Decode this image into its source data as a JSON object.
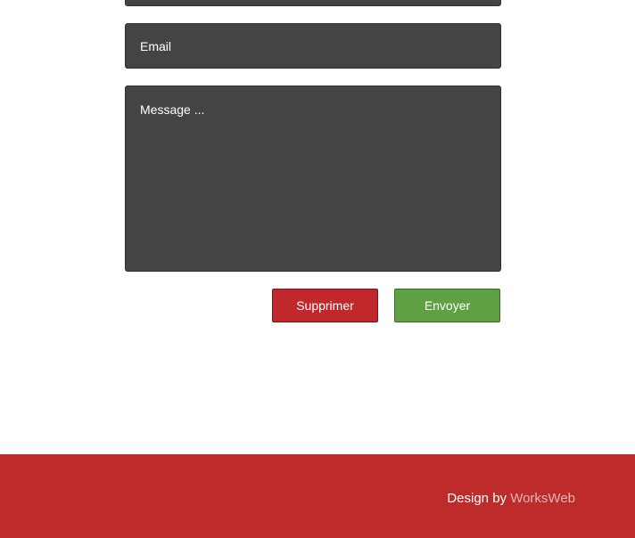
{
  "form": {
    "email_placeholder": "Email",
    "message_placeholder": "Message ...",
    "delete_label": "Supprimer",
    "send_label": "Envoyer"
  },
  "footer": {
    "credit_prefix": "Design by",
    "credit_link": "WorksWeb"
  },
  "colors": {
    "field_background": "#444444",
    "delete_button": "#c0282b",
    "send_button": "#5ea043",
    "footer_background": "#bd2b2b",
    "link_color": "#e0b8b8"
  }
}
